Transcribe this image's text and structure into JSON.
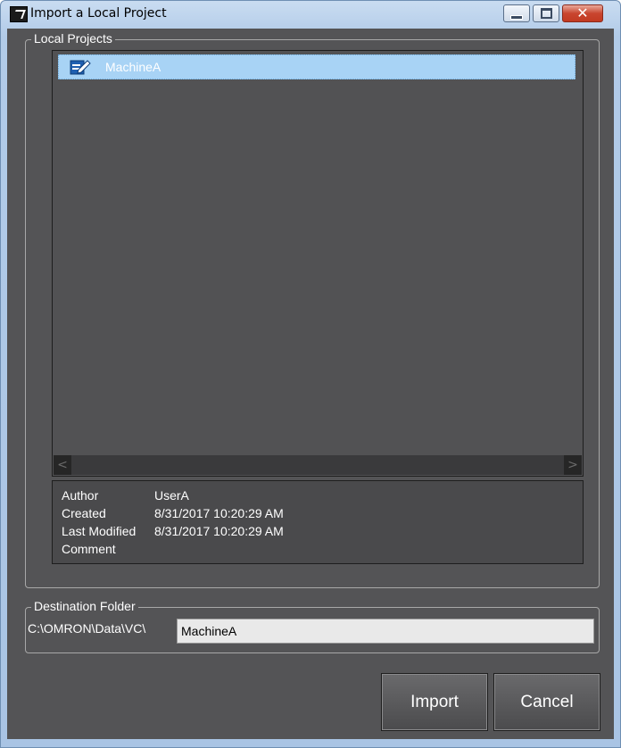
{
  "window": {
    "title": "Import a Local Project",
    "icon": "app-logo-icon",
    "controls": [
      "minimize-icon",
      "maximize-icon",
      "close-icon"
    ]
  },
  "local_projects": {
    "group_label": "Local Projects",
    "items": [
      {
        "label": "MachineA",
        "icon": "project-edit-icon",
        "selected": true
      }
    ],
    "scroll_left": "<",
    "scroll_right": ">"
  },
  "details": {
    "author_label": "Author",
    "author_value": "UserA",
    "created_label": "Created",
    "created_value": "8/31/2017 10:20:29 AM",
    "modified_label": "Last Modified",
    "modified_value": "8/31/2017 10:20:29 AM",
    "comment_label": "Comment",
    "comment_value": ""
  },
  "destination": {
    "group_label": "Destination Folder",
    "path_prefix": "C:\\OMRON\\Data\\VC\\",
    "folder_value": "MachineA"
  },
  "buttons": {
    "import_label": "Import",
    "cancel_label": "Cancel"
  },
  "colors": {
    "background": "#545456",
    "selection": "#a8d3f5",
    "titlebar": "#b2cbe8"
  }
}
